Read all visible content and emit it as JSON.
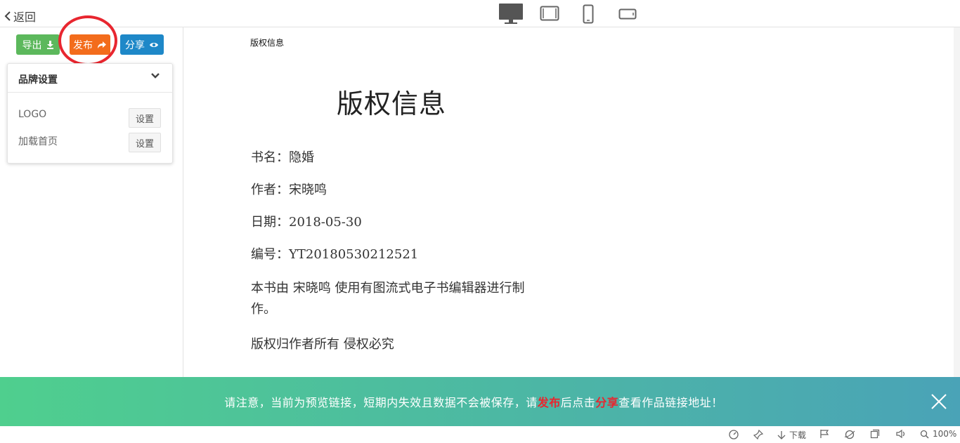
{
  "topbar": {
    "back_label": "返回",
    "devices": [
      "desktop-icon",
      "tablet-landscape-icon",
      "phone-portrait-icon",
      "phone-landscape-icon"
    ]
  },
  "toolbar": {
    "export_label": "导出",
    "publish_label": "发布",
    "share_label": "分享"
  },
  "brand_panel": {
    "title": "品牌设置",
    "rows": [
      {
        "label": "LOGO",
        "button": "设置"
      },
      {
        "label": "加载首页",
        "button": "设置"
      }
    ]
  },
  "document": {
    "breadcrumb": "版权信息",
    "title": "版权信息",
    "lines": [
      "书名：隐婚",
      "作者：宋晓鸣",
      "日期：2018-05-30",
      "编号：YT20180530212521",
      "本书由 宋晓鸣 使用有图流式电子书编辑器进行制作。",
      "版权归作者所有 侵权必究"
    ]
  },
  "notice": {
    "part1": "请注意，当前为预览链接，短期内失效且数据不会被保存，请",
    "highlight1": "发布",
    "part2": "后点击",
    "highlight2": "分享",
    "part3": "查看作品链接地址！"
  },
  "statusbar": {
    "download_label": "下载",
    "zoom_label": "100%"
  },
  "colors": {
    "export": "#5cb85c",
    "publish": "#f36c1c",
    "share": "#1e88c8",
    "highlight": "#e8262f",
    "notice_start": "#4fcf8e",
    "notice_end": "#4aa3b7"
  }
}
